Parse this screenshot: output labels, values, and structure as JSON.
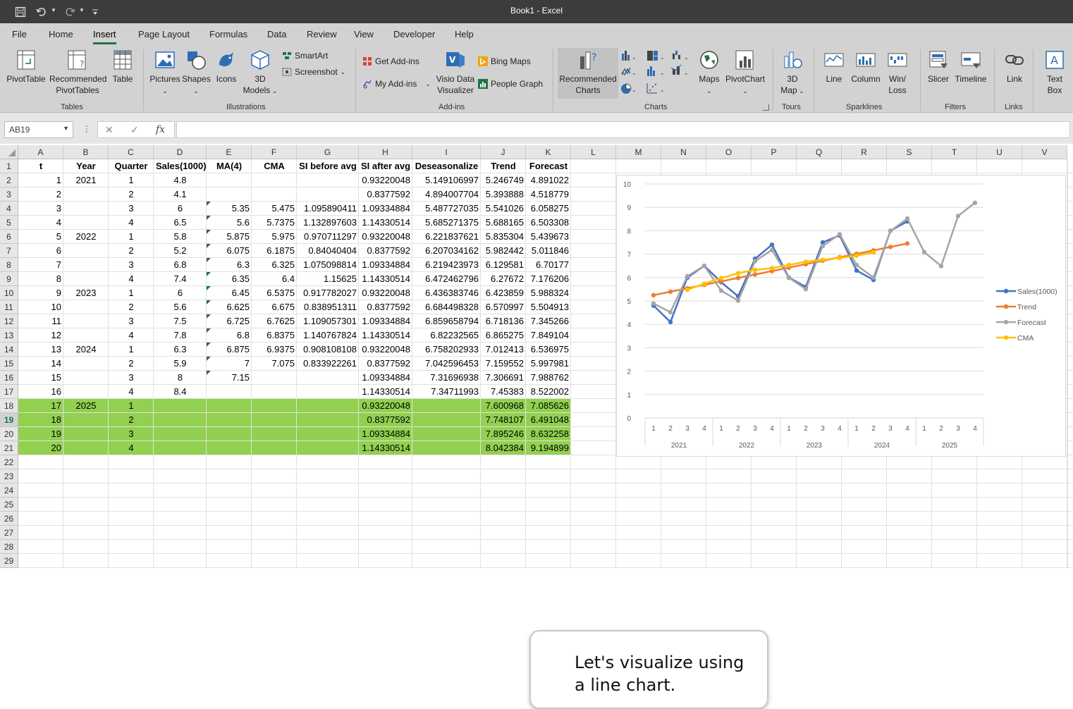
{
  "window": {
    "title": "Book1  -  Excel"
  },
  "ribbon_tabs": [
    "File",
    "Home",
    "Insert",
    "Page Layout",
    "Formulas",
    "Data",
    "Review",
    "View",
    "Developer",
    "Help"
  ],
  "active_tab": "Insert",
  "ribbon": {
    "tables": {
      "pivottable": "PivotTable",
      "recommended_pivot_1": "Recommended",
      "recommended_pivot_2": "PivotTables",
      "table": "Table",
      "group": "Tables"
    },
    "illustrations": {
      "pictures": "Pictures",
      "shapes": "Shapes",
      "icons": "Icons",
      "models_1": "3D",
      "models_2": "Models",
      "smartart": "SmartArt",
      "screenshot": "Screenshot",
      "group": "Illustrations"
    },
    "addins": {
      "get": "Get Add-ins",
      "my": "My Add-ins",
      "visio_1": "Visio Data",
      "visio_2": "Visualizer",
      "bing": "Bing Maps",
      "people": "People Graph",
      "group": "Add-ins"
    },
    "charts": {
      "recommended_1": "Recommended",
      "recommended_2": "Charts",
      "maps": "Maps",
      "pivotchart": "PivotChart",
      "group": "Charts"
    },
    "tours": {
      "map_1": "3D",
      "map_2": "Map",
      "group": "Tours"
    },
    "sparklines": {
      "line": "Line",
      "column": "Column",
      "winloss_1": "Win/",
      "winloss_2": "Loss",
      "group": "Sparklines"
    },
    "filters": {
      "slicer": "Slicer",
      "timeline": "Timeline",
      "group": "Filters"
    },
    "links": {
      "link": "Link",
      "group": "Links"
    },
    "text": {
      "textbox_1": "Text",
      "textbox_2": "Box"
    }
  },
  "formula_bar": {
    "name_box": "AB19",
    "fx": "fx",
    "formula": ""
  },
  "columns": [
    "A",
    "B",
    "C",
    "D",
    "E",
    "F",
    "G",
    "H",
    "I",
    "J",
    "K",
    "L",
    "M",
    "N",
    "O",
    "P",
    "Q",
    "R",
    "S",
    "T",
    "U",
    "V"
  ],
  "rows": [
    "1",
    "2",
    "3",
    "4",
    "5",
    "6",
    "7",
    "8",
    "9",
    "10",
    "11",
    "12",
    "13",
    "14",
    "15",
    "16",
    "17",
    "18",
    "19",
    "20",
    "21",
    "22",
    "23",
    "24",
    "25",
    "26",
    "27",
    "28",
    "29"
  ],
  "selected_row": "19",
  "headers": [
    "t",
    "Year",
    "Quarter",
    "Sales(1000)",
    "MA(4)",
    "CMA",
    "SI before avg",
    "SI after avg",
    "Deseasonalize",
    "Trend",
    "Forecast"
  ],
  "table": [
    [
      "1",
      "2021",
      "1",
      "4.8",
      "",
      "",
      "",
      "0.93220048",
      "5.149106997",
      "5.246749",
      "4.891022"
    ],
    [
      "2",
      "",
      "2",
      "4.1",
      "",
      "",
      "",
      "0.8377592",
      "4.894007704",
      "5.393888",
      "4.518779"
    ],
    [
      "3",
      "",
      "3",
      "6",
      "5.35",
      "5.475",
      "1.095890411",
      "1.09334884",
      "5.487727035",
      "5.541026",
      "6.058275"
    ],
    [
      "4",
      "",
      "4",
      "6.5",
      "5.6",
      "5.7375",
      "1.132897603",
      "1.14330514",
      "5.685271375",
      "5.688165",
      "6.503308"
    ],
    [
      "5",
      "2022",
      "1",
      "5.8",
      "5.875",
      "5.975",
      "0.970711297",
      "0.93220048",
      "6.221837621",
      "5.835304",
      "5.439673"
    ],
    [
      "6",
      "",
      "2",
      "5.2",
      "6.075",
      "6.1875",
      "0.84040404",
      "0.8377592",
      "6.207034162",
      "5.982442",
      "5.011846"
    ],
    [
      "7",
      "",
      "3",
      "6.8",
      "6.3",
      "6.325",
      "1.075098814",
      "1.09334884",
      "6.219423973",
      "6.129581",
      "6.70177"
    ],
    [
      "8",
      "",
      "4",
      "7.4",
      "6.35",
      "6.4",
      "1.15625",
      "1.14330514",
      "6.472462796",
      "6.27672",
      "7.176206"
    ],
    [
      "9",
      "2023",
      "1",
      "6",
      "6.45",
      "6.5375",
      "0.917782027",
      "0.93220048",
      "6.436383746",
      "6.423859",
      "5.988324"
    ],
    [
      "10",
      "",
      "2",
      "5.6",
      "6.625",
      "6.675",
      "0.838951311",
      "0.8377592",
      "6.684498328",
      "6.570997",
      "5.504913"
    ],
    [
      "11",
      "",
      "3",
      "7.5",
      "6.725",
      "6.7625",
      "1.109057301",
      "1.09334884",
      "6.859658794",
      "6.718136",
      "7.345266"
    ],
    [
      "12",
      "",
      "4",
      "7.8",
      "6.8",
      "6.8375",
      "1.140767824",
      "1.14330514",
      "6.82232565",
      "6.865275",
      "7.849104"
    ],
    [
      "13",
      "2024",
      "1",
      "6.3",
      "6.875",
      "6.9375",
      "0.908108108",
      "0.93220048",
      "6.758202933",
      "7.012413",
      "6.536975"
    ],
    [
      "14",
      "",
      "2",
      "5.9",
      "7",
      "7.075",
      "0.833922261",
      "0.8377592",
      "7.042596453",
      "7.159552",
      "5.997981"
    ],
    [
      "15",
      "",
      "3",
      "8",
      "7.15",
      "",
      "",
      "1.09334884",
      "7.31696938",
      "7.306691",
      "7.988762"
    ],
    [
      "16",
      "",
      "4",
      "8.4",
      "",
      "",
      "",
      "1.14330514",
      "7.34711993",
      "7.45383",
      "8.522002"
    ],
    [
      "17",
      "2025",
      "1",
      "",
      "",
      "",
      "",
      "0.93220048",
      "",
      "7.600968",
      "7.085626"
    ],
    [
      "18",
      "",
      "2",
      "",
      "",
      "",
      "",
      "0.8377592",
      "",
      "7.748107",
      "6.491048"
    ],
    [
      "19",
      "",
      "3",
      "",
      "",
      "",
      "",
      "1.09334884",
      "",
      "7.895246",
      "8.632258"
    ],
    [
      "20",
      "",
      "4",
      "",
      "",
      "",
      "",
      "1.14330514",
      "",
      "8.042384",
      "9.194899"
    ]
  ],
  "chart_data": {
    "type": "line",
    "categories": [
      "1",
      "2",
      "3",
      "4",
      "1",
      "2",
      "3",
      "4",
      "1",
      "2",
      "3",
      "4",
      "1",
      "2",
      "3",
      "4",
      "1",
      "2",
      "3",
      "4"
    ],
    "category_groups": [
      "2021",
      "2022",
      "2023",
      "2024",
      "2025"
    ],
    "ylim": [
      0,
      10
    ],
    "yticks": [
      "0",
      "1",
      "2",
      "3",
      "4",
      "5",
      "6",
      "7",
      "8",
      "9",
      "10"
    ],
    "legend_position": "right",
    "series": [
      {
        "name": "Sales(1000)",
        "color": "#4472c4",
        "values": [
          4.8,
          4.1,
          6,
          6.5,
          5.8,
          5.2,
          6.8,
          7.4,
          6,
          5.6,
          7.5,
          7.8,
          6.3,
          5.9,
          8,
          8.4,
          null,
          null,
          null,
          null
        ]
      },
      {
        "name": "Trend",
        "color": "#ed7d31",
        "values": [
          5.246749,
          5.393888,
          5.541026,
          5.688165,
          5.835304,
          5.982442,
          6.129581,
          6.27672,
          6.423859,
          6.570997,
          6.718136,
          6.865275,
          7.012413,
          7.159552,
          7.306691,
          7.45383,
          null,
          null,
          null,
          null
        ]
      },
      {
        "name": "Forecast",
        "color": "#a5a5a5",
        "values": [
          4.891022,
          4.518779,
          6.058275,
          6.503308,
          5.439673,
          5.011846,
          6.70177,
          7.176206,
          5.988324,
          5.504913,
          7.345266,
          7.849104,
          6.536975,
          5.997981,
          7.988762,
          8.522002,
          7.085626,
          6.491048,
          8.632258,
          9.194899
        ]
      },
      {
        "name": "CMA",
        "color": "#ffc000",
        "values": [
          null,
          null,
          5.475,
          5.7375,
          5.975,
          6.1875,
          6.325,
          6.4,
          6.5375,
          6.675,
          6.7625,
          6.8375,
          6.9375,
          7.075,
          null,
          null,
          null,
          null,
          null,
          null
        ]
      }
    ]
  },
  "callout": {
    "text": "Let's visualize using a line chart."
  }
}
